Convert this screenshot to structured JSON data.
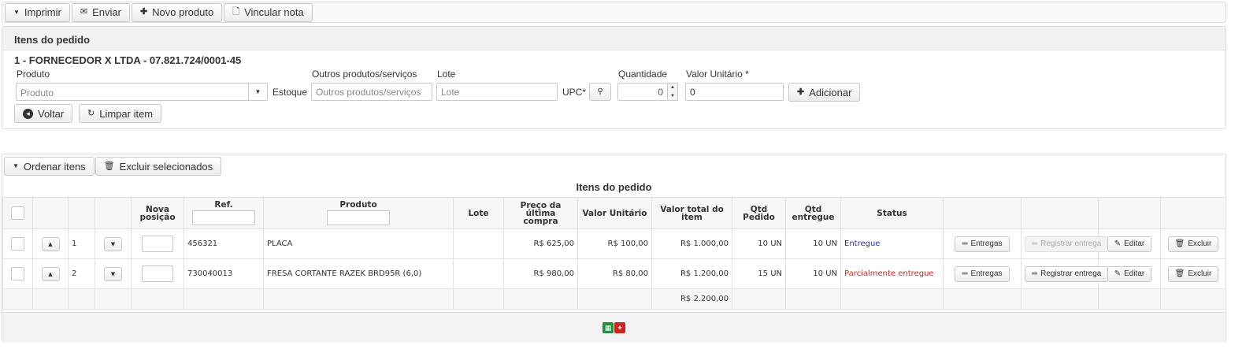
{
  "toolbar": {
    "print": "Imprimir",
    "send": "Enviar",
    "new_product": "Novo produto",
    "link_note": "Vincular nota"
  },
  "item_form": {
    "panel_title": "Itens do pedido",
    "supplier": "1 - FORNECEDOR X LTDA - 07.821.724/0001-45",
    "product_label": "Produto",
    "product_placeholder": "Produto",
    "stock_label": "Estoque",
    "other_label": "Outros produtos/serviços",
    "other_placeholder": "Outros produtos/serviços",
    "lot_label": "Lote",
    "lot_placeholder": "Lote",
    "upc_label": "UPC*",
    "qty_label": "Quantidade",
    "qty_value": "0",
    "unit_value_label": "Valor Unitário *",
    "unit_value": "0",
    "add_button": "Adicionar",
    "back_button": "Voltar",
    "clear_button": "Limpar item"
  },
  "table": {
    "order_items_button": "Ordenar itens",
    "delete_selected_button": "Excluir selecionados",
    "title": "Itens do pedido",
    "headers": {
      "new_position": "Nova posição",
      "ref": "Ref.",
      "product": "Produto",
      "lot": "Lote",
      "last_price": "Preço da última compra",
      "unit_value": "Valor Unitário",
      "total_value": "Valor total do item",
      "qty_ordered": "Qtd Pedido",
      "qty_delivered": "Qtd entregue",
      "status": "Status"
    },
    "rows": [
      {
        "index": "1",
        "ref": "456321",
        "product": "PLACA",
        "lot": "",
        "last_price": "R$ 625,00",
        "unit_value": "R$ 100,00",
        "total_value": "R$ 1.000,00",
        "qty_ordered": "10 UN",
        "qty_delivered": "10 UN",
        "status": "Entregue",
        "deliveries_button": "Entregas",
        "register_button": "Registrar entrega",
        "edit_button": "Editar",
        "delete_button": "Excluir"
      },
      {
        "index": "2",
        "ref": "730040013",
        "product": "FRESA CORTANTE RAZEK BRD95R (6,0)",
        "lot": "",
        "last_price": "R$ 980,00",
        "unit_value": "R$ 80,00",
        "total_value": "R$ 1.200,00",
        "qty_ordered": "15 UN",
        "qty_delivered": "10 UN",
        "status": "Parcialmente entregue",
        "deliveries_button": "Entregas",
        "register_button": "Registrar entrega",
        "edit_button": "Editar",
        "delete_button": "Excluir"
      }
    ],
    "total": "R$ 2.200,00"
  },
  "colors": {
    "status_delivered": "#1f2ccf",
    "status_partial": "#e0201e",
    "excel": "#1f8f3a",
    "pdf": "#d61f1f"
  },
  "icons": [
    "caret-down-icon",
    "envelope-icon",
    "plus-icon",
    "file-icon",
    "search-icon",
    "arrow-left-circle-icon",
    "undo-icon",
    "trash-icon",
    "chevron-up-icon",
    "chevron-down-icon",
    "equals-icon",
    "pencil-icon",
    "excel-icon",
    "pdf-icon"
  ]
}
